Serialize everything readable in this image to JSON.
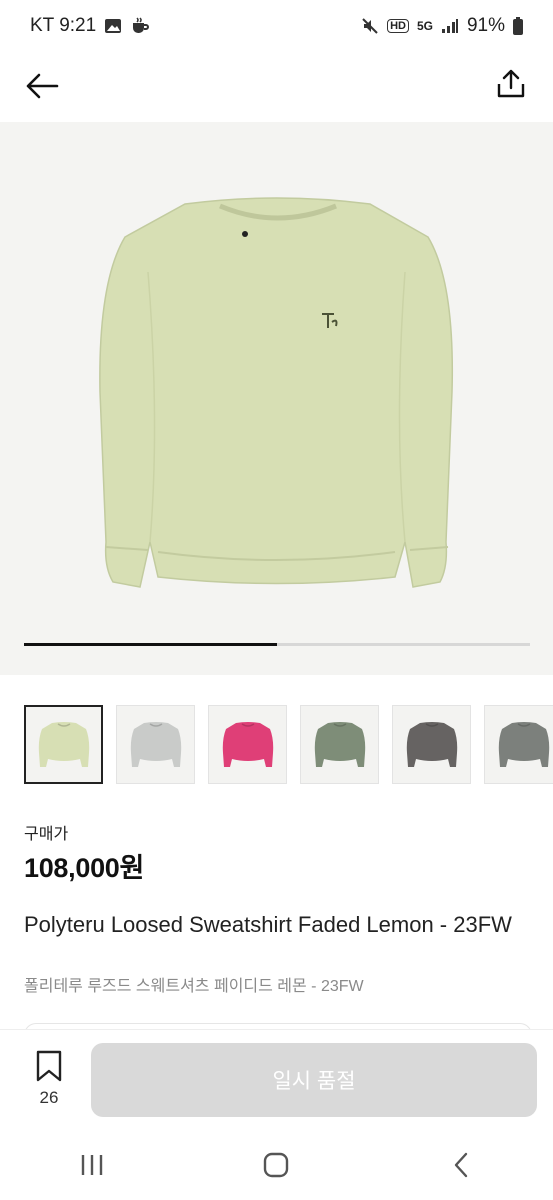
{
  "status_bar": {
    "carrier_time": "KT 9:21",
    "network": "HD",
    "network_gen": "5G",
    "battery": "91%",
    "icons": [
      "gallery-icon",
      "coffee-icon",
      "mute-icon",
      "signal-icon",
      "battery-icon"
    ]
  },
  "top_bar": {
    "back_icon": "arrow-left-icon",
    "share_icon": "share-icon"
  },
  "gallery": {
    "progress": 0.5,
    "thumbnails": [
      {
        "color": "#d7dfb4",
        "selected": true
      },
      {
        "color": "#c9cbc9",
        "selected": false
      },
      {
        "color": "#df3f77",
        "selected": false
      },
      {
        "color": "#7e8d78",
        "selected": false
      },
      {
        "color": "#666362",
        "selected": false
      },
      {
        "color": "#7c807c",
        "selected": false
      }
    ]
  },
  "product": {
    "price_label": "구매가",
    "price": "108,000원",
    "title": "Polyteru Loosed Sweatshirt Faded Lemon - 23FW",
    "subtitle": "폴리테루 루즈드 스웨트셔츠 페이디드 레몬 - 23FW"
  },
  "bottom_bar": {
    "bookmark_count": "26",
    "buy_label": "일시 품절"
  },
  "nav_bar": {
    "items": [
      "recent-apps-icon",
      "home-icon",
      "back-icon"
    ]
  },
  "colors": {
    "sweatshirt": "#d7dfb4",
    "button_disabled": "#d9d9d9"
  }
}
